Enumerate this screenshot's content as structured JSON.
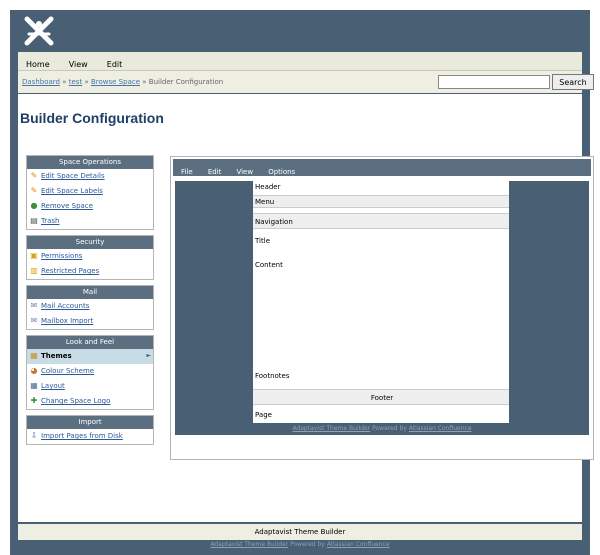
{
  "menubar": {
    "items": [
      "Home",
      "View",
      "Edit"
    ]
  },
  "breadcrumb": {
    "items": [
      "Dashboard",
      "test",
      "Browse Space"
    ],
    "separator": "»",
    "current": "Builder Configuration"
  },
  "search": {
    "button_label": "Search",
    "value": ""
  },
  "page_title": "Builder Configuration",
  "sidebar": {
    "panels": [
      {
        "title": "Space Operations",
        "items": [
          {
            "label": "Edit Space Details",
            "icon": "pencil-icon"
          },
          {
            "label": "Edit Space Labels",
            "icon": "pencil-icon"
          },
          {
            "label": "Remove Space",
            "icon": "remove-icon"
          },
          {
            "label": "Trash",
            "icon": "trash-icon"
          }
        ]
      },
      {
        "title": "Security",
        "items": [
          {
            "label": "Permissions",
            "icon": "lock-icon"
          },
          {
            "label": "Restricted Pages",
            "icon": "page-lock-icon"
          }
        ]
      },
      {
        "title": "Mail",
        "items": [
          {
            "label": "Mail Accounts",
            "icon": "mail-icon"
          },
          {
            "label": "Mailbox Import",
            "icon": "mail-import-icon"
          }
        ]
      },
      {
        "title": "Look and Feel",
        "items": [
          {
            "label": "Themes",
            "icon": "themes-icon",
            "active": true
          },
          {
            "label": "Colour Scheme",
            "icon": "palette-icon"
          },
          {
            "label": "Layout",
            "icon": "layout-icon"
          },
          {
            "label": "Change Space Logo",
            "icon": "logo-icon"
          }
        ]
      },
      {
        "title": "Import",
        "items": [
          {
            "label": "Import Pages from Disk",
            "icon": "import-icon"
          }
        ]
      }
    ]
  },
  "builder": {
    "menu": [
      "File",
      "Edit",
      "View",
      "Options"
    ],
    "regions": {
      "header": "Header",
      "menu": "Menu",
      "navigation": "Navigation",
      "title": "Title",
      "content": "Content",
      "footnotes": "Footnotes",
      "footer": "Footer",
      "page": "Page"
    },
    "powered": {
      "link1": "Adaptavist Theme Builder",
      "middle": "Powered by",
      "link2": "Atlassian Confluence"
    }
  },
  "footer": {
    "bar_text": "Adaptavist Theme Builder",
    "powered": {
      "link1": "Adaptavist Theme Builder",
      "middle": "Powered by",
      "link2": "Atlassian Confluence"
    }
  },
  "colors": {
    "frame": "#495f73",
    "panel_head": "#5c6f80",
    "title": "#1f3f67",
    "link": "#2a5a99",
    "active": "#c8dce6"
  }
}
